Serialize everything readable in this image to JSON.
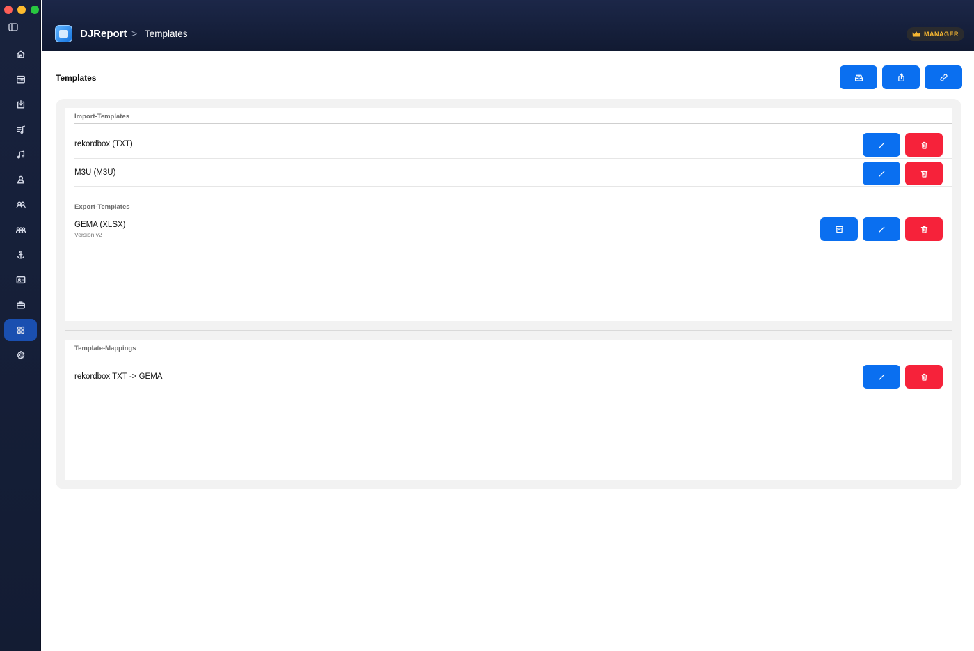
{
  "header": {
    "app_title": "DJReport",
    "breadcrumb_separator": ">",
    "breadcrumb_current": "Templates",
    "role_badge": "MANAGER",
    "badge_color": "#f7b731"
  },
  "sidebar": {
    "items": [
      {
        "name": "home-icon",
        "active": false
      },
      {
        "name": "calendar-icon",
        "active": false
      },
      {
        "name": "import-icon",
        "active": false
      },
      {
        "name": "playlist-icon",
        "active": false
      },
      {
        "name": "music-notes-icon",
        "active": false
      },
      {
        "name": "user-icon",
        "active": false
      },
      {
        "name": "users-icon",
        "active": false
      },
      {
        "name": "group-icon",
        "active": false
      },
      {
        "name": "anchor-icon",
        "active": false
      },
      {
        "name": "id-card-icon",
        "active": false
      },
      {
        "name": "briefcase-icon",
        "active": false
      },
      {
        "name": "grid-icon",
        "active": true
      },
      {
        "name": "gear-icon",
        "active": false
      }
    ]
  },
  "main": {
    "page_title": "Templates",
    "top_actions": [
      "import-icon",
      "share-icon",
      "link-icon"
    ],
    "import_section": {
      "label": "Import-Templates",
      "rows": [
        {
          "name": "rekordbox (TXT)"
        },
        {
          "name": "M3U (M3U)"
        }
      ]
    },
    "export_section": {
      "label": "Export-Templates",
      "rows": [
        {
          "name": "GEMA (XLSX)",
          "subtitle": "Version v2"
        }
      ]
    },
    "mapping_section": {
      "label": "Template-Mappings",
      "rows": [
        {
          "name": "rekordbox TXT -> GEMA"
        }
      ]
    }
  },
  "colors": {
    "primary_button": "#0a6ff0",
    "danger_button": "#f6223a",
    "sidebar_active": "#1a4fb0"
  }
}
